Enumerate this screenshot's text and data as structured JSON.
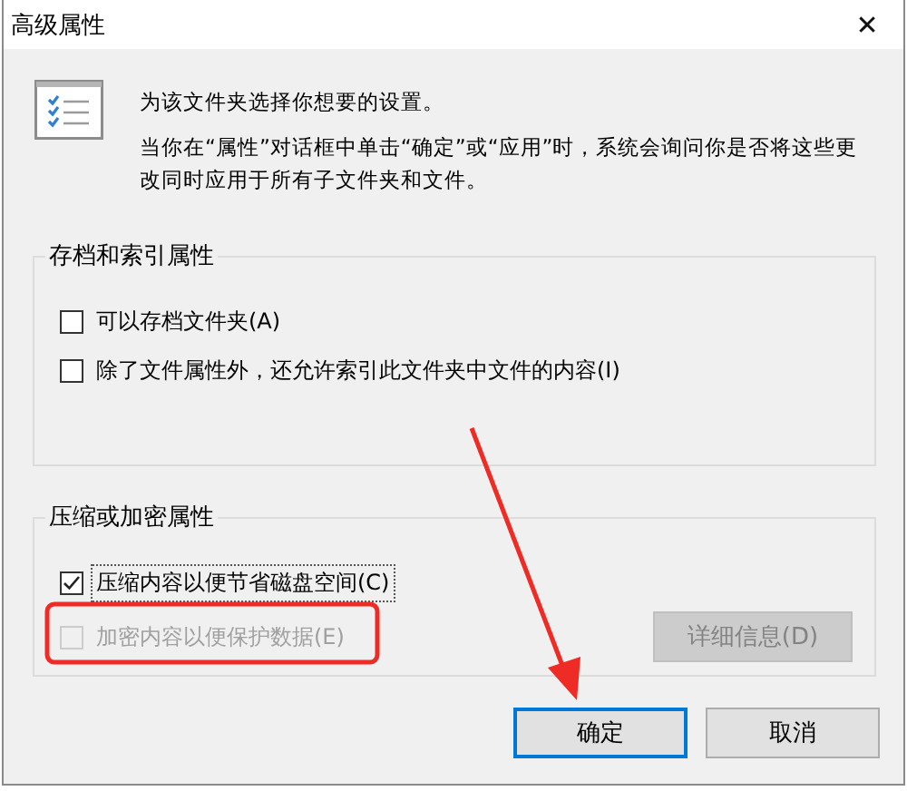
{
  "window": {
    "title": "高级属性",
    "close": "✕"
  },
  "intro": [
    "为该文件夹选择你想要的设置。",
    "当你在“属性”对话框中单击“确定”或“应用”时，系统会询问你是否将这些更改同时应用于所有子文件夹和文件。"
  ],
  "groups": [
    {
      "legend": "存档和索引属性",
      "options": [
        {
          "label": "可以存档文件夹(A)",
          "checked": false,
          "disabled": false,
          "focused": false
        },
        {
          "label": "除了文件属性外，还允许索引此文件夹中文件的内容(I)",
          "checked": false,
          "disabled": false,
          "focused": false
        }
      ]
    },
    {
      "legend": "压缩或加密属性",
      "options": [
        {
          "label": "压缩内容以便节省磁盘空间(C)",
          "checked": true,
          "disabled": false,
          "focused": true
        },
        {
          "label": "加密内容以便保护数据(E)",
          "checked": false,
          "disabled": true,
          "focused": false
        }
      ],
      "details_button": {
        "label": "详细信息(D)",
        "disabled": true
      }
    }
  ],
  "buttons": [
    {
      "label": "确定",
      "default": true
    },
    {
      "label": "取消",
      "default": false
    }
  ]
}
